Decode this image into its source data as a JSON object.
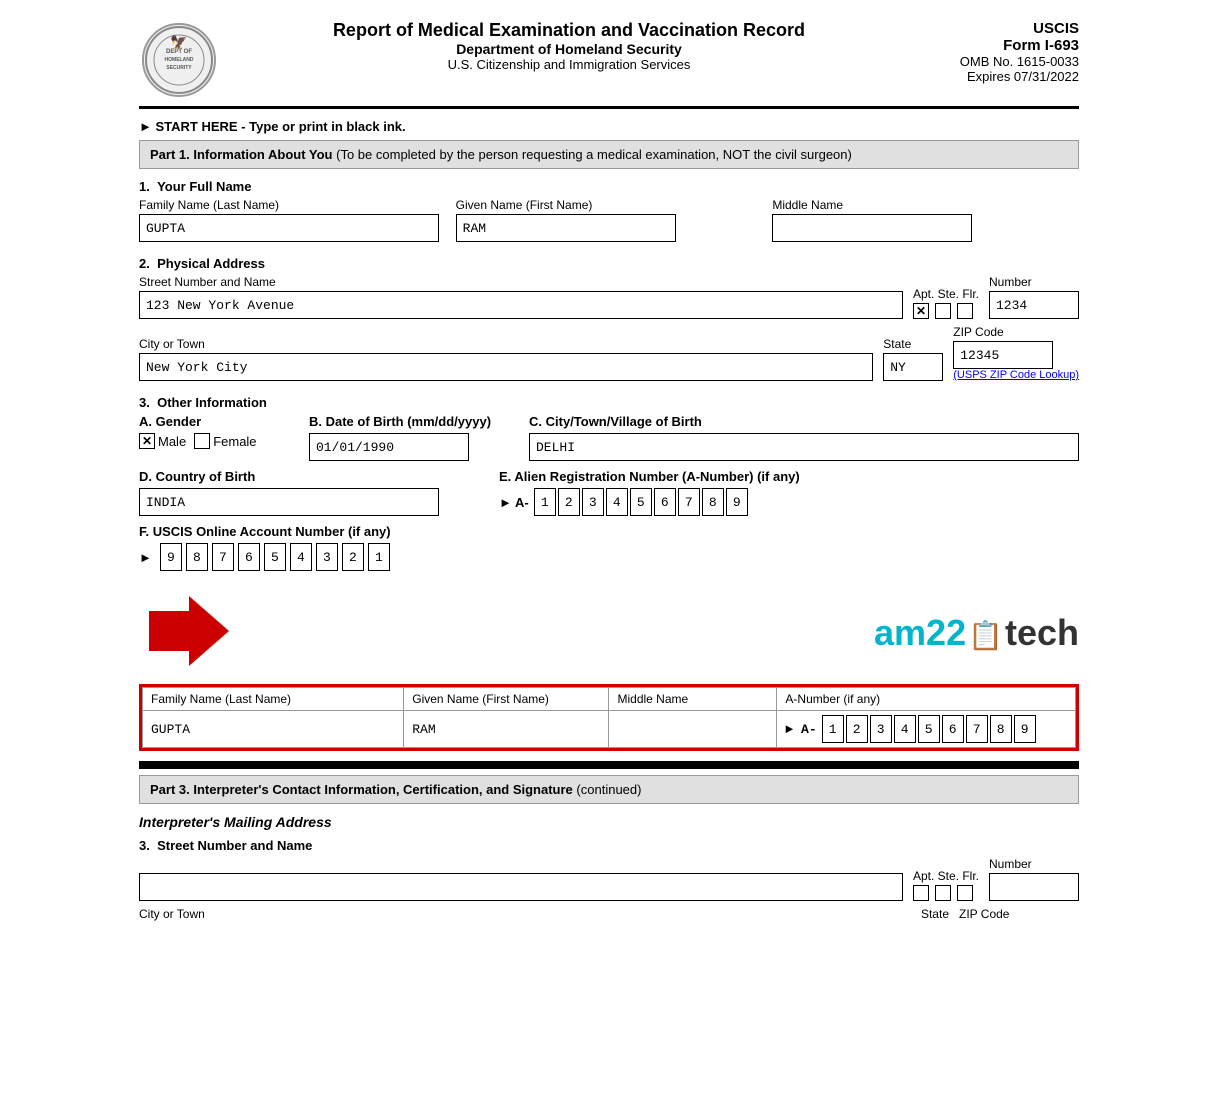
{
  "header": {
    "form_title": "Report of Medical Examination and Vaccination Record",
    "sub_title": "Department of Homeland Security",
    "sub_title2": "U.S. Citizenship and Immigration Services",
    "uscis_label": "USCIS",
    "form_id": "Form I-693",
    "omb": "OMB No. 1615-0033",
    "expires": "Expires 07/31/2022",
    "logo_text": "DEPT OF HOMELAND SECURITY"
  },
  "start_here": "► START HERE - Type or print in black ink.",
  "part1": {
    "label": "Part 1.",
    "title": "Information About You",
    "subtitle": "(To be completed by the person requesting a medical examination, NOT the civil surgeon)"
  },
  "section1": {
    "number": "1.",
    "title": "Your Full Name",
    "family_name_label": "Family Name (Last Name)",
    "family_name_value": "GUPTA",
    "given_name_label": "Given Name (First Name)",
    "given_name_value": "RAM",
    "middle_name_label": "Middle Name",
    "middle_name_value": ""
  },
  "section2": {
    "number": "2.",
    "title": "Physical Address",
    "street_label": "Street Number and Name",
    "street_value": "123 New York Avenue",
    "apt_label": "Apt. Ste. Flr.",
    "number_label": "Number",
    "number_value": "1234",
    "apt_checked": true,
    "ste_checked": false,
    "flr_checked": false,
    "city_label": "City or Town",
    "city_value": "New York City",
    "state_label": "State",
    "state_value": "NY",
    "zip_label": "ZIP Code",
    "zip_value": "12345",
    "usps_link": "(USPS ZIP Code Lookup)"
  },
  "section3": {
    "number": "3.",
    "title": "Other Information",
    "gender_label": "A. Gender",
    "male_checked": true,
    "female_checked": false,
    "male_label": "Male",
    "female_label": "Female",
    "dob_label": "B. Date of Birth (mm/dd/yyyy)",
    "dob_value": "01/01/1990",
    "city_birth_label": "C. City/Town/Village of Birth",
    "city_birth_value": "DELHI",
    "country_birth_label": "D. Country of Birth",
    "country_birth_value": "INDIA",
    "alien_label": "E. Alien Registration Number (A-Number) (if any)",
    "alien_arrow": "► A-",
    "alien_digits": [
      "1",
      "2",
      "3",
      "4",
      "5",
      "6",
      "7",
      "8",
      "9"
    ],
    "online_account_label": "F. USCIS Online Account Number (if any)",
    "online_arrow": "►",
    "online_digits": [
      "9",
      "8",
      "7",
      "6",
      "5",
      "4",
      "3",
      "2",
      "1"
    ]
  },
  "bottom_table": {
    "col1_header": "Family Name (Last Name)",
    "col2_header": "Given Name (First Name)",
    "col3_header": "Middle Name",
    "col4_header": "A-Number (if any)",
    "col1_value": "GUPTA",
    "col2_value": "RAM",
    "col3_value": "",
    "a_arrow": "► A-",
    "a_digits": [
      "1",
      "2",
      "3",
      "4",
      "5",
      "6",
      "7",
      "8",
      "9"
    ]
  },
  "part3": {
    "label": "Part 3.",
    "title": "Interpreter's Contact Information, Certification, and Signature",
    "subtitle": "(continued)"
  },
  "interpreter_address": {
    "title": "Interpreter's Mailing Address",
    "section_number": "3.",
    "street_label": "Street Number and Name",
    "street_value": "",
    "apt_label": "Apt. Ste. Flr.",
    "number_label": "Number",
    "number_value": "",
    "apt_checked": false,
    "ste_checked": false,
    "flr_checked": false,
    "city_label": "City or Town",
    "state_label": "State",
    "zip_label": "ZIP Code"
  }
}
